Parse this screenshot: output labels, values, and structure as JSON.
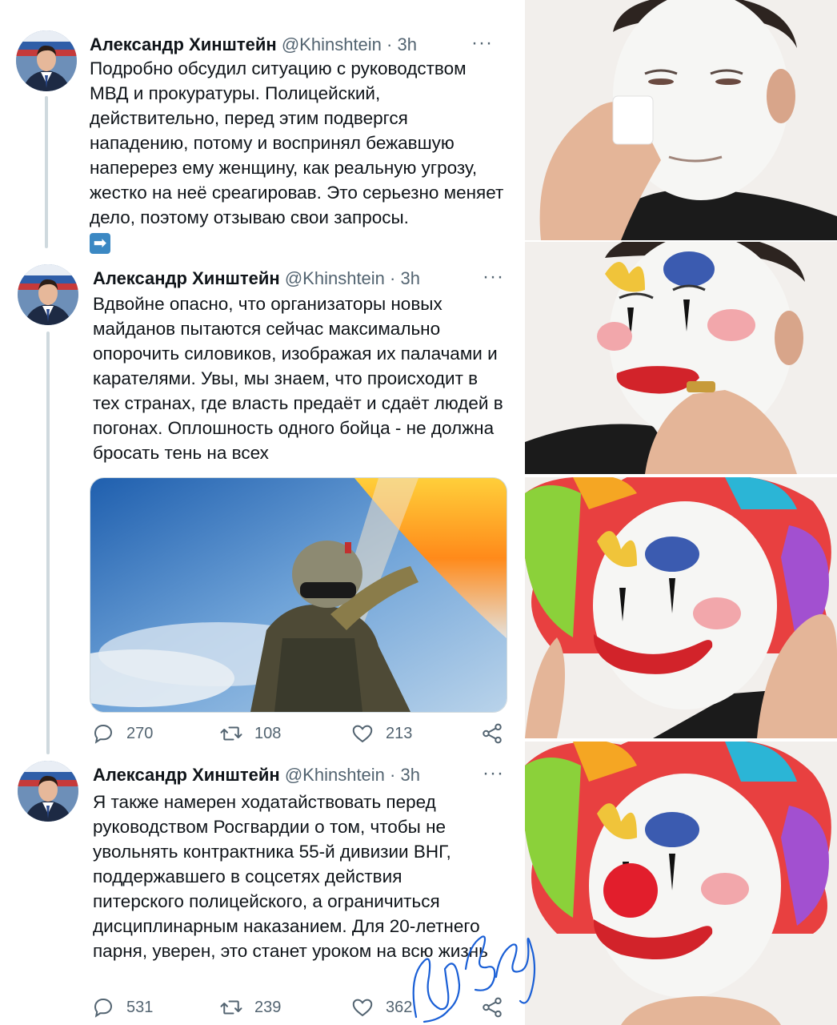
{
  "tweets": [
    {
      "name": "Александр Хинштейн",
      "handle": "@Khinshtein",
      "separator": "·",
      "time": "3h",
      "more": "···",
      "text": "Подробно обсудил ситуацию с руководством МВД и прокуратуры. Полицейский, действительно, перед этим подвергся нападению, потому и воспринял бежавшую наперерез ему женщину, как реальную угрозу, жестко на неё среагировав. Это серьезно меняет дело, поэтому отзываю свои запросы.",
      "emoji": "➡"
    },
    {
      "name": "Александр Хинштейн",
      "handle": "@Khinshtein",
      "separator": "·",
      "time": "3h",
      "more": "···",
      "text": "Вдвойне опасно, что организаторы новых майданов пытаются сейчас максимально опорочить силовиков, изображая их палачами и карателями. Увы, мы знаем, что происходит в тех странах, где власть предаёт и сдаёт людей в погонах. Оплошность одного бойца - не должна бросать тень на всех",
      "replies": "270",
      "retweets": "108",
      "likes": "213"
    },
    {
      "name": "Александр Хинштейн",
      "handle": "@Khinshtein",
      "separator": "·",
      "time": "3h",
      "more": "···",
      "text": "Я также намерен ходатайствовать перед руководством Росгвардии о том, чтобы не увольнять контрактника 55-й дивизии ВНГ, поддержавшего в соцсетях действия питерского полицейского, а ограничиться дисциплинарным наказанием. Для 20-летнего парня, уверен, это станет уроком на всю жизнь",
      "replies": "531",
      "retweets": "239",
      "likes": "362"
    }
  ],
  "icons": {
    "reply": "reply-icon",
    "retweet": "retweet-icon",
    "like": "heart-icon",
    "share": "share-icon"
  },
  "watermark": "by Bobby",
  "colors": {
    "text": "#0f1419",
    "muted": "#536471",
    "thread": "#cfd9de",
    "signature": "#1a5fd6"
  }
}
